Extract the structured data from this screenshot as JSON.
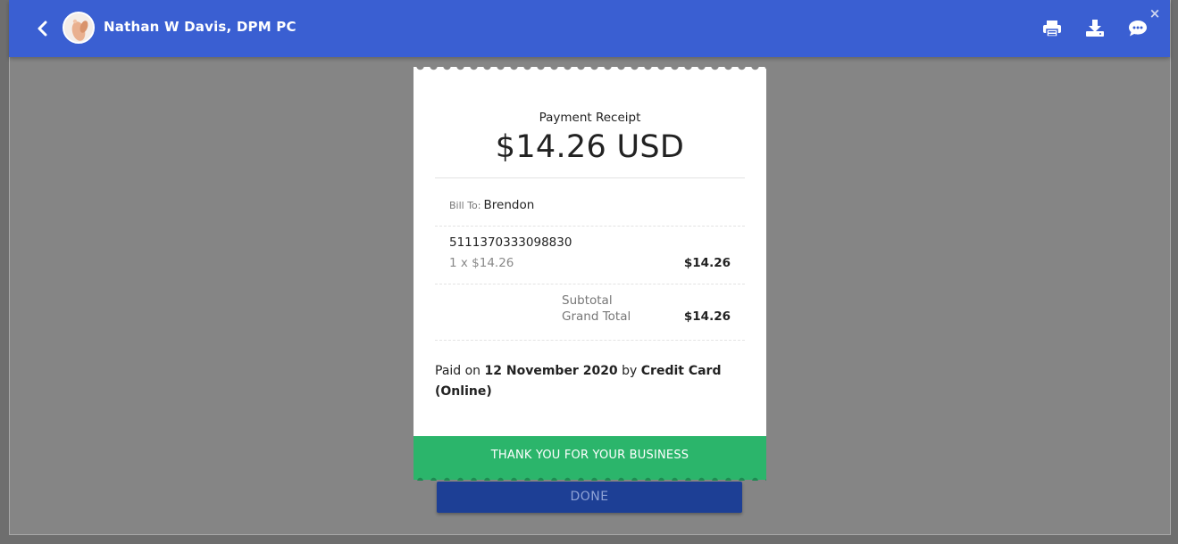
{
  "header": {
    "title": "Nathan W Davis, DPM PC",
    "icons": {
      "back": "chevron-left-icon",
      "print": "print-icon",
      "download": "download-icon",
      "chat": "chat-icon",
      "close": "close-icon"
    },
    "close_glyph": "×",
    "color": "#3a5fd2"
  },
  "receipt": {
    "label": "Payment Receipt",
    "amount": "$14.26 USD",
    "bill_to_label": "Bill To:",
    "bill_to_name": "Brendon",
    "item": {
      "code": "5111370333098830",
      "qty_line": "1 x $14.26",
      "amount": "$14.26"
    },
    "subtotal_label": "Subtotal",
    "grand_total_label": "Grand Total",
    "grand_total_amount": "$14.26",
    "paid": {
      "prefix": "Paid on",
      "date": "12 November 2020",
      "by": "by",
      "method": "Credit Card (Online)"
    },
    "thanks": "THANK YOU FOR YOUR BUSINESS",
    "accent": "#2bb56b"
  },
  "footer": {
    "done_label": "DONE",
    "done_color": "#1d3f95"
  }
}
